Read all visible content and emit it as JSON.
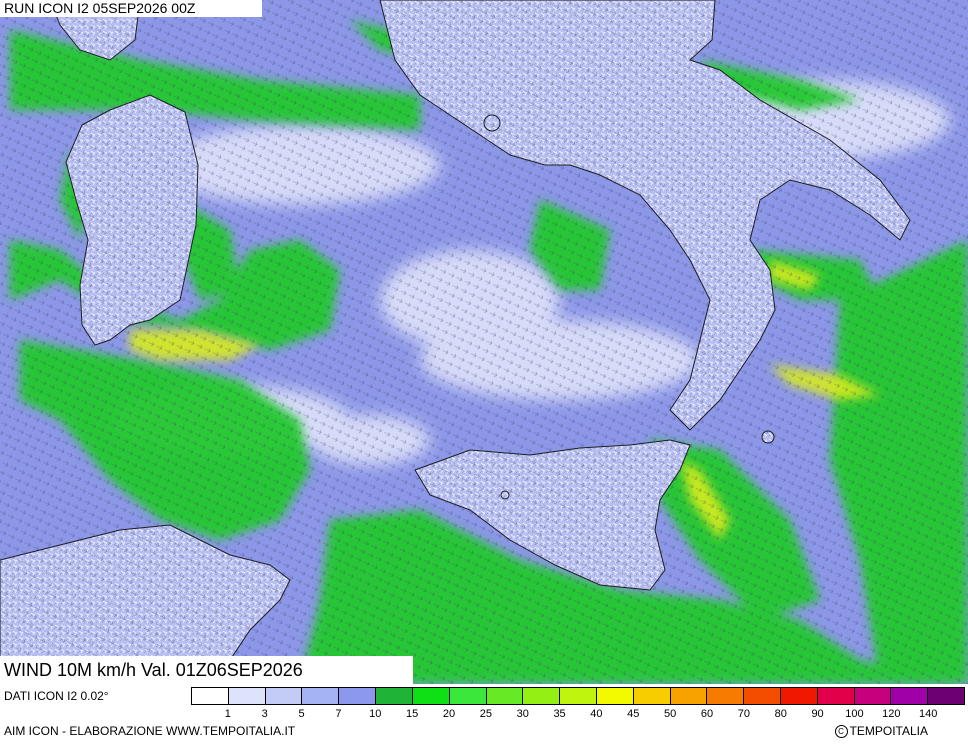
{
  "header": {
    "run_label": "RUN ICON I2 05SEP2026 00Z"
  },
  "map": {
    "variable_label": "WIND 10M km/h Val. 01Z06SEP2026",
    "colors": {
      "sea_base": "#8c97e8",
      "land": "#aab4f0",
      "calm": "#e4e7fb",
      "wind_green": "#22c92e",
      "wind_yellow": "#d7ec1a"
    }
  },
  "legend": {
    "data_source": "DATI ICON I2 0.02°",
    "scale_colors": [
      "#ffffff",
      "#dde3fb",
      "#c2ccf7",
      "#a5b2f3",
      "#8b98ee",
      "#1fb437",
      "#0ee015",
      "#39e83a",
      "#66ea24",
      "#94ef13",
      "#bff40f",
      "#f3fa00",
      "#f8cd00",
      "#f8a200",
      "#f77b00",
      "#f44d00",
      "#f01800",
      "#e2004b",
      "#c7007d",
      "#a000a7",
      "#6d0072"
    ],
    "tick_labels": [
      "1",
      "3",
      "5",
      "7",
      "10",
      "15",
      "20",
      "25",
      "30",
      "35",
      "40",
      "45",
      "50",
      "60",
      "70",
      "80",
      "90",
      "100",
      "120",
      "140"
    ]
  },
  "footer": {
    "credit_left": "AIM ICON - ELABORAZIONE WWW.TEMPOITALIA.IT",
    "credit_right": "TEMPOITALIA",
    "copyright_symbol": "C"
  }
}
